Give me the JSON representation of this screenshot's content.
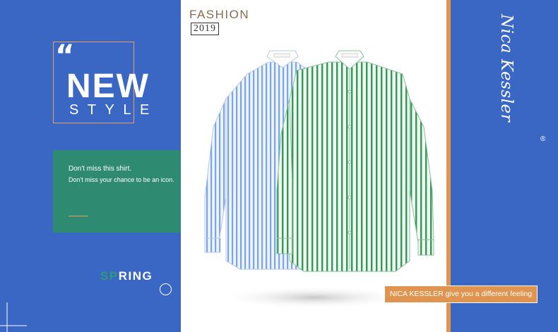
{
  "header": {
    "kicker": "FASHION",
    "year": "2019"
  },
  "hero": {
    "quote_mark": "“",
    "title": "NEW",
    "subtitle": "STYLE"
  },
  "promo": {
    "line1": "Don't miss this shirt.",
    "line2": "Don't miss your chance to be an icon."
  },
  "season": {
    "highlight": "SP",
    "rest": "RING"
  },
  "brand": {
    "name": "Nica Kessler",
    "registered": "®"
  },
  "tagline": "NICA KESSLER give you a different feeling",
  "colors": {
    "panel_blue": "#3a66c4",
    "accent_orange": "#df9450",
    "promo_green": "#2f8a72",
    "shirt_blue_stripe": "#7aa6e4",
    "shirt_green_stripe": "#2f9a5a"
  },
  "product_names": [
    "blue-striped-shirt",
    "green-striped-shirt"
  ]
}
